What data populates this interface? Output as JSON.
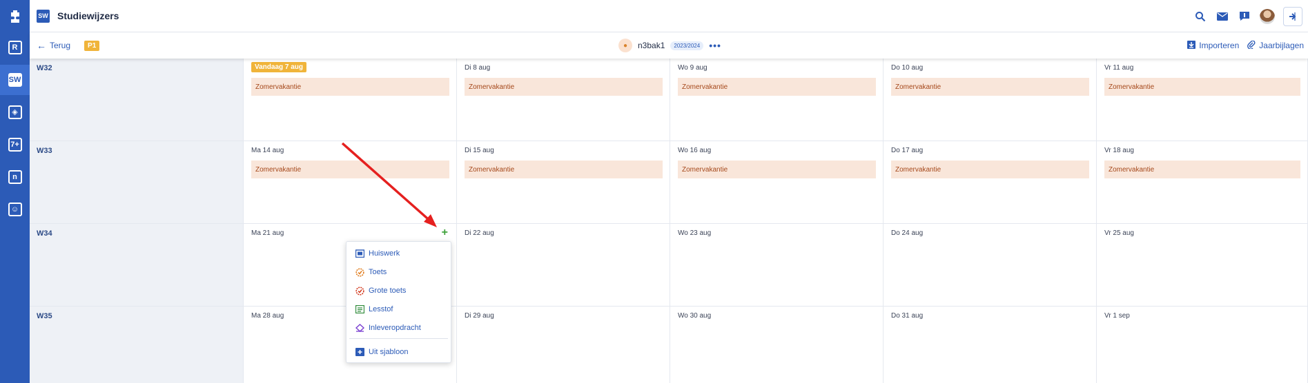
{
  "colors": {
    "rail": "#2c5bb7",
    "accent": "#2c5bb7",
    "today": "#f0b43a",
    "vacation_bg": "#f9e6da",
    "vacation_text": "#a5481b",
    "add_green": "#3fa23b",
    "annotation_arrow": "#e5201f"
  },
  "rail": {
    "logo_icon": "puzzle-icon",
    "items": [
      {
        "icon": "r-calendar-icon",
        "glyph": "R"
      },
      {
        "icon": "studiewijzer-icon",
        "glyph": "SW",
        "active": true
      },
      {
        "icon": "eraser-icon",
        "glyph": "◈"
      },
      {
        "icon": "grades-icon",
        "glyph": "7+"
      },
      {
        "icon": "n-icon",
        "glyph": "n"
      },
      {
        "icon": "students-icon",
        "glyph": "☺"
      }
    ]
  },
  "header": {
    "app_badge": "SW",
    "title": "Studiewijzers",
    "icons": [
      "search-icon",
      "mail-icon",
      "chat-icon",
      "avatar",
      "logout-icon"
    ]
  },
  "subbar": {
    "back_label": "Terug",
    "period_badge": "P1",
    "class_name": "n3bak1",
    "school_year": "2023/2024",
    "more": "•••",
    "import_label": "Importeren",
    "attachments_label": "Jaarbijlagen"
  },
  "weeks": [
    {
      "label": "W32",
      "days": [
        {
          "date": "Vandaag 7 aug",
          "today": true,
          "event": "Zomervakantie"
        },
        {
          "date": "Di 8 aug",
          "event": "Zomervakantie"
        },
        {
          "date": "Wo 9 aug",
          "event": "Zomervakantie"
        },
        {
          "date": "Do 10 aug",
          "event": "Zomervakantie"
        },
        {
          "date": "Vr 11 aug",
          "event": "Zomervakantie"
        }
      ]
    },
    {
      "label": "W33",
      "days": [
        {
          "date": "Ma 14 aug",
          "event": "Zomervakantie"
        },
        {
          "date": "Di 15 aug",
          "event": "Zomervakantie"
        },
        {
          "date": "Wo 16 aug",
          "event": "Zomervakantie"
        },
        {
          "date": "Do 17 aug",
          "event": "Zomervakantie"
        },
        {
          "date": "Vr 18 aug",
          "event": "Zomervakantie"
        }
      ]
    },
    {
      "label": "W34",
      "days": [
        {
          "date": "Ma 21 aug",
          "add_button": "+"
        },
        {
          "date": "Di 22 aug"
        },
        {
          "date": "Wo 23 aug"
        },
        {
          "date": "Do 24 aug"
        },
        {
          "date": "Vr 25 aug"
        }
      ]
    },
    {
      "label": "W35",
      "days": [
        {
          "date": "Ma 28 aug"
        },
        {
          "date": "Di 29 aug"
        },
        {
          "date": "Wo 30 aug"
        },
        {
          "date": "Do 31 aug"
        },
        {
          "date": "Vr 1 sep"
        }
      ]
    }
  ],
  "add_menu": {
    "items": [
      {
        "label": "Huiswerk",
        "icon": "homework-icon",
        "color": "#2c5bb7"
      },
      {
        "label": "Toets",
        "icon": "test-icon",
        "color": "#e07b1a"
      },
      {
        "label": "Grote toets",
        "icon": "big-test-icon",
        "color": "#d23a1e"
      },
      {
        "label": "Lesstof",
        "icon": "lesson-material-icon",
        "color": "#2e8b3a"
      },
      {
        "label": "Inleveropdracht",
        "icon": "assignment-icon",
        "color": "#7a3ed1"
      }
    ],
    "template_item": {
      "label": "Uit sjabloon",
      "icon": "template-icon",
      "color": "#2c5bb7"
    }
  }
}
